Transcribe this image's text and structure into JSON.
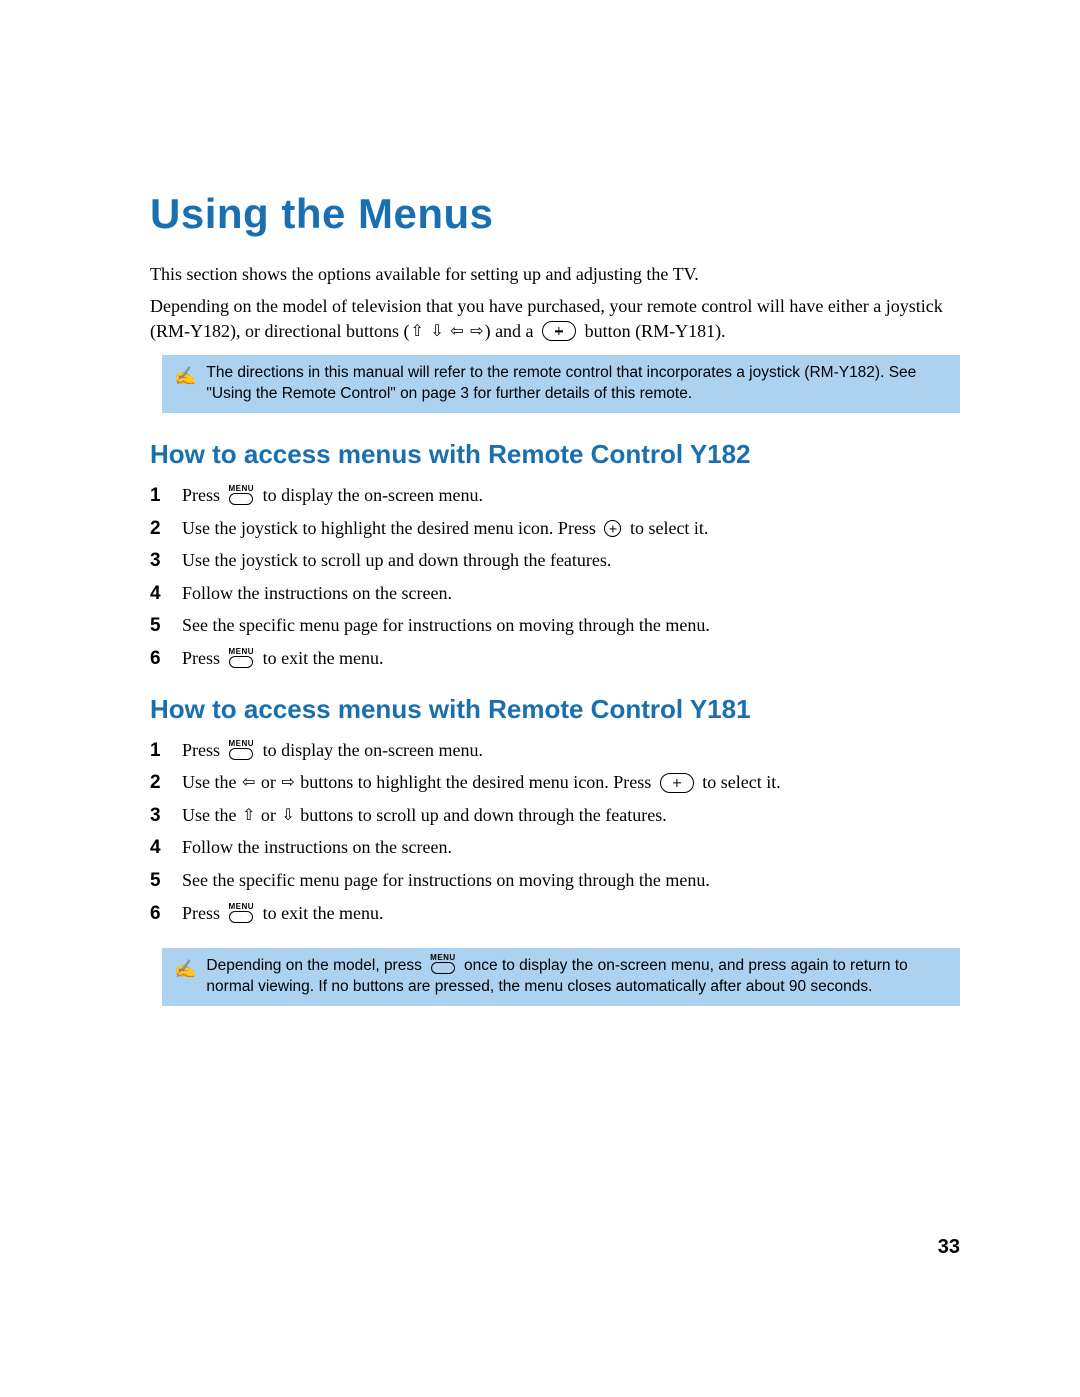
{
  "title": "Using the Menus",
  "intro": [
    "This section shows the options available for setting up and adjusting the TV.",
    "Depending on the model of television that you have purchased, your remote control will have either a joystick (RM-Y182), or directional buttons ("
  ],
  "intro_tail": " button (RM-Y181).",
  "intro_and_a": ") and a ",
  "note1": "The directions in this manual will refer to the remote control that incorporates a joystick (RM-Y182). See \"Using the Remote Control\" on page 3 for further details of this remote.",
  "section_y182": {
    "heading": "How to access menus with Remote Control Y182",
    "steps": [
      {
        "pre": "Press ",
        "btn": "menu",
        "post": " to display the on-screen menu."
      },
      {
        "pre": "Use the joystick to highlight the desired menu icon. Press ",
        "btn": "plus-circ",
        "post": " to select it."
      },
      {
        "pre": "Use the joystick to scroll up and down through the features."
      },
      {
        "pre": "Follow the instructions on the screen."
      },
      {
        "pre": "See the specific menu page for instructions on moving through the menu."
      },
      {
        "pre": "Press ",
        "btn": "menu",
        "post": " to exit the menu."
      }
    ]
  },
  "section_y181": {
    "heading": "How to access menus with Remote Control Y181",
    "steps": [
      {
        "pre": "Press ",
        "btn": "menu",
        "post": " to display the on-screen menu."
      },
      {
        "pre": "Use the ",
        "arrows": "lr",
        "mid": " buttons to highlight the desired menu icon. Press ",
        "btn": "plus-btn",
        "post": " to select it."
      },
      {
        "pre": "Use the ",
        "arrows": "ud",
        "mid": " buttons to scroll up and down through the features."
      },
      {
        "pre": "Follow the instructions on the screen."
      },
      {
        "pre": "See the specific menu page for instructions on moving through the menu."
      },
      {
        "pre": "Press ",
        "btn": "menu",
        "post": " to exit the menu."
      }
    ]
  },
  "note2_a": "Depending on the model, press ",
  "note2_b": " once to display the on-screen menu, and press again to return to normal viewing. If no buttons are pressed, the menu closes automatically after about 90 seconds.",
  "page_number": "33",
  "glyphs": {
    "up": "⇧",
    "down": "⇩",
    "left": "⇦",
    "right": "⇨",
    "or": " or "
  }
}
